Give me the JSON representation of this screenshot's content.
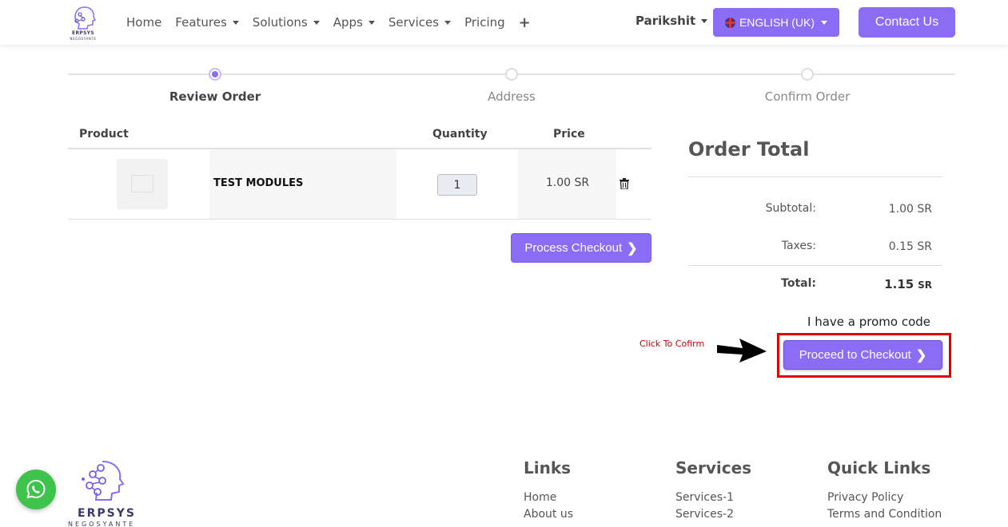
{
  "header": {
    "brand": "ERPSYS",
    "brand_sub": "NEGOSYANTE",
    "nav": [
      {
        "label": "Home",
        "dropdown": false
      },
      {
        "label": "Features",
        "dropdown": true
      },
      {
        "label": "Solutions",
        "dropdown": true
      },
      {
        "label": "Apps",
        "dropdown": true
      },
      {
        "label": "Services",
        "dropdown": true
      },
      {
        "label": "Pricing",
        "dropdown": false
      }
    ],
    "plus_icon": "+",
    "user": "Parikshit",
    "language": "ENGLISH (UK)",
    "contact_label": "Contact Us"
  },
  "steps": [
    {
      "label": "Review Order",
      "active": true
    },
    {
      "label": "Address",
      "active": false
    },
    {
      "label": "Confirm Order",
      "active": false
    }
  ],
  "cart": {
    "columns": {
      "product": "Product",
      "quantity": "Quantity",
      "price": "Price"
    },
    "items": [
      {
        "name": "TEST MODULES",
        "quantity": "1",
        "price": "1.00 SR"
      }
    ],
    "process_label": "Process Checkout"
  },
  "order_total": {
    "title": "Order Total",
    "subtotal_label": "Subtotal:",
    "subtotal_value": "1.00 SR",
    "taxes_label": "Taxes:",
    "taxes_value": "0.15 SR",
    "total_label": "Total:",
    "total_value": "1.15",
    "total_unit": "SR",
    "promo": "I have a promo code",
    "proceed_label": "Proceed to Checkout",
    "hint": "Click To Cofirm"
  },
  "footer": {
    "links": {
      "title": "Links",
      "items": [
        "Home",
        "About us"
      ]
    },
    "services": {
      "title": "Services",
      "items": [
        "Services-1",
        "Services-2"
      ]
    },
    "quick": {
      "title": "Quick Links",
      "items": [
        "Privacy Policy",
        "Terms and Condition"
      ]
    }
  },
  "colors": {
    "accent": "#8b6cf5",
    "highlight": "#e00000",
    "whatsapp": "#3ec34d"
  }
}
